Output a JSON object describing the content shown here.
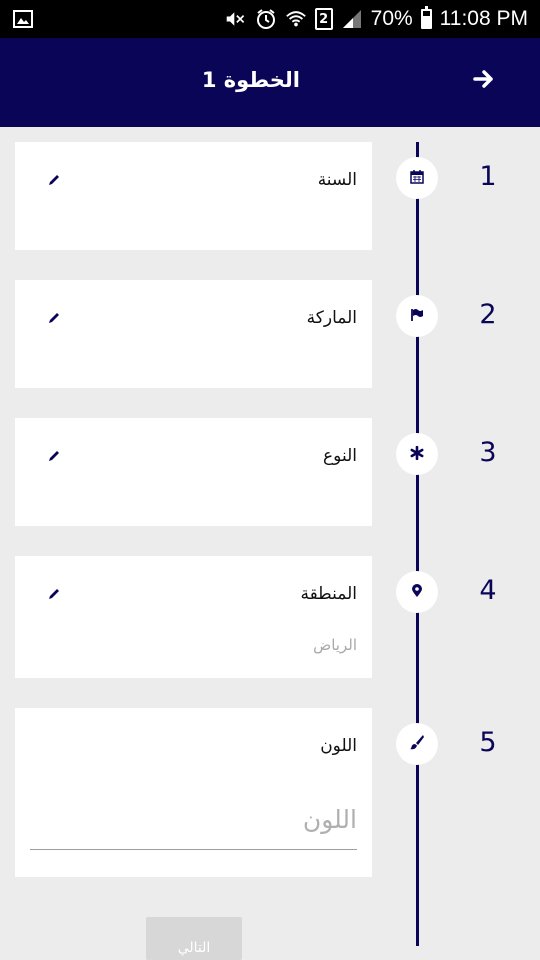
{
  "status_bar": {
    "battery_text": "70%",
    "battery_level": 0.7,
    "sim_slot": "2",
    "time": "11:08 PM",
    "icons": [
      "image-icon",
      "mute-icon",
      "alarm-icon",
      "wifi-icon",
      "sim-icon",
      "signal-icon",
      "battery-icon"
    ]
  },
  "app_bar": {
    "title": "الخطوة 1",
    "back_icon": "arrow-right-icon",
    "color": "#0b0558"
  },
  "steps": [
    {
      "number": "1",
      "label": "السنة",
      "icon": "calendar-icon",
      "editable": true,
      "value": ""
    },
    {
      "number": "2",
      "label": "الماركة",
      "icon": "flag-icon",
      "editable": true,
      "value": ""
    },
    {
      "number": "3",
      "label": "النوع",
      "icon": "asterisk-icon",
      "editable": true,
      "value": ""
    },
    {
      "number": "4",
      "label": "المنطقة",
      "icon": "map-marker-icon",
      "editable": true,
      "value": "الرياض"
    },
    {
      "number": "5",
      "label": "اللون",
      "icon": "paint-brush-icon",
      "editable": false,
      "input_placeholder": "اللون",
      "input_value": ""
    }
  ],
  "next_button": {
    "label": "التالي"
  }
}
